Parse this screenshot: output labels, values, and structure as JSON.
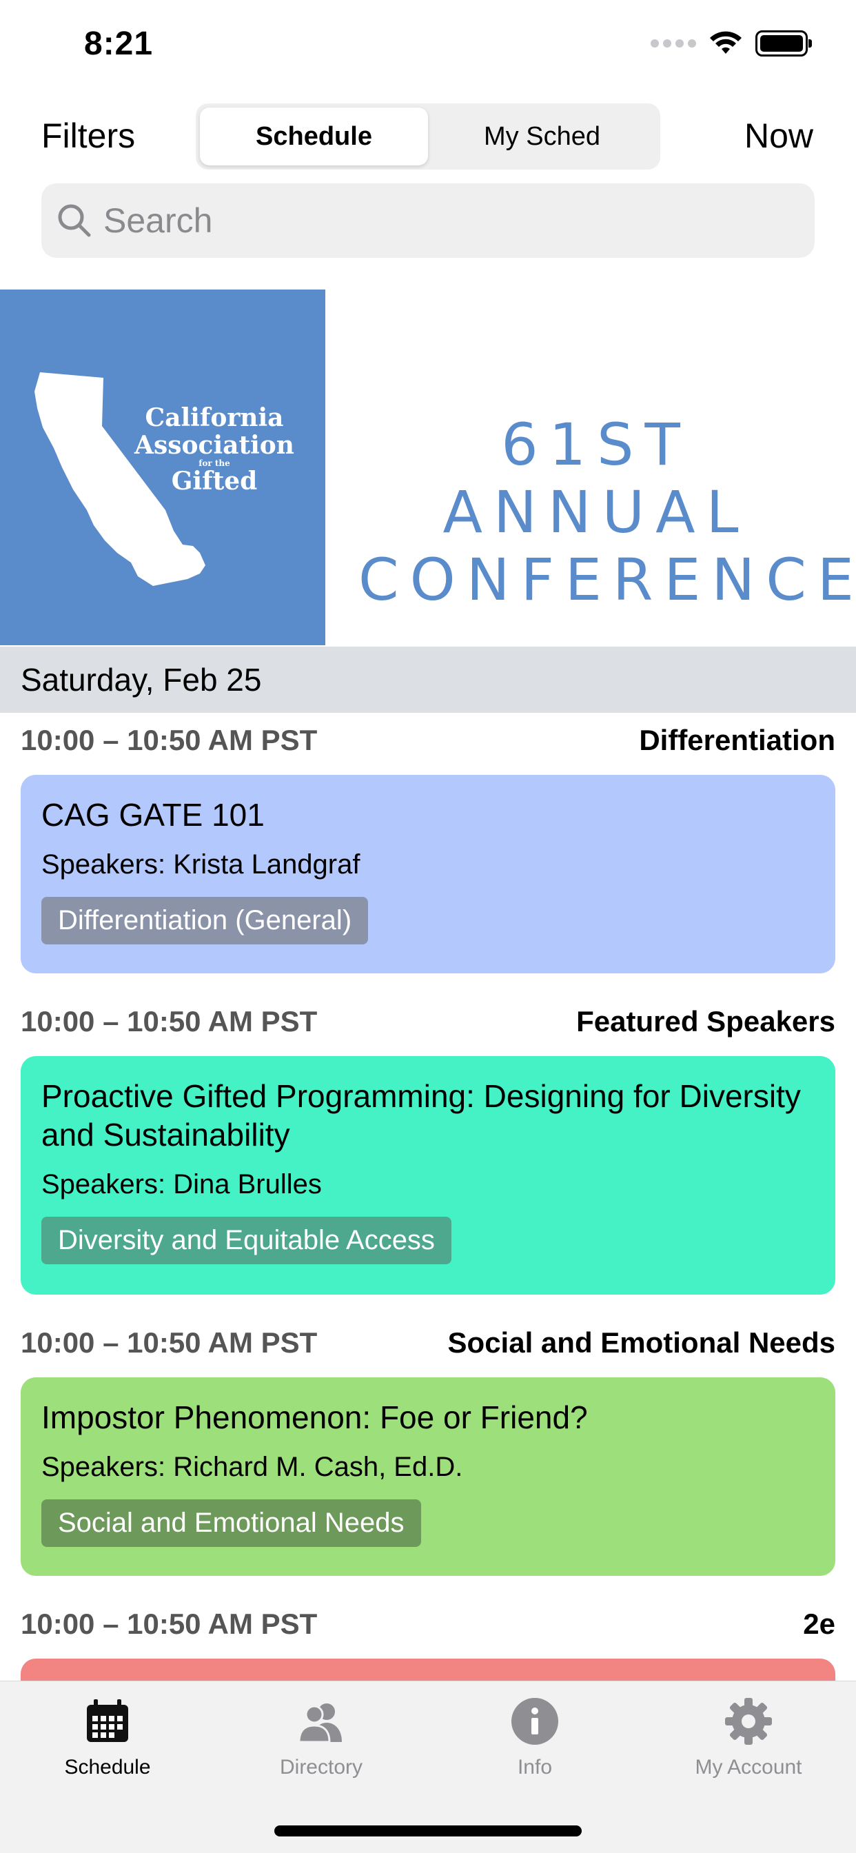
{
  "status_bar": {
    "time": "8:21"
  },
  "nav": {
    "filters_label": "Filters",
    "now_label": "Now",
    "segments": [
      {
        "label": "Schedule",
        "active": true
      },
      {
        "label": "My Sched",
        "active": false
      }
    ]
  },
  "search": {
    "placeholder": "Search"
  },
  "banner": {
    "logo_text": [
      "California",
      "Association",
      "for the",
      "Gifted"
    ],
    "title_line1": "61ST ANNUAL",
    "title_line2": "CONFERENCE",
    "brand_color": "#5a8bcb"
  },
  "day_header": "Saturday, Feb 25",
  "sessions": [
    {
      "time": "10:00 – 10:50 AM PST",
      "track": "Differentiation",
      "title": "CAG GATE 101",
      "speakers": "Speakers: Krista Landgraf",
      "tag": "Differentiation (General)",
      "card_color": "#b3c8fc",
      "tag_color": "#8a93a8"
    },
    {
      "time": "10:00 – 10:50 AM PST",
      "track": "Featured Speakers",
      "title": "Proactive Gifted Programming: Designing for Diversity and Sustainability",
      "speakers": "Speakers: Dina Brulles",
      "tag": "Diversity and Equitable Access",
      "card_color": "#44f2c6",
      "tag_color": "#4da88d"
    },
    {
      "time": "10:00 – 10:50 AM PST",
      "track": "Social and Emotional Needs",
      "title": "Impostor Phenomenon: Foe or Friend?",
      "speakers": "Speakers: Richard M. Cash, Ed.D.",
      "tag": "Social and Emotional Needs",
      "card_color": "#9ddf7b",
      "tag_color": "#6d9a5a"
    },
    {
      "time": "10:00 – 10:50 AM PST",
      "track": "2e",
      "card_color": "#f28482"
    }
  ],
  "tab_bar": {
    "tabs": [
      {
        "label": "Schedule",
        "icon": "calendar-icon",
        "active": true
      },
      {
        "label": "Directory",
        "icon": "people-icon",
        "active": false
      },
      {
        "label": "Info",
        "icon": "info-icon",
        "active": false
      },
      {
        "label": "My Account",
        "icon": "gear-icon",
        "active": false
      }
    ]
  }
}
